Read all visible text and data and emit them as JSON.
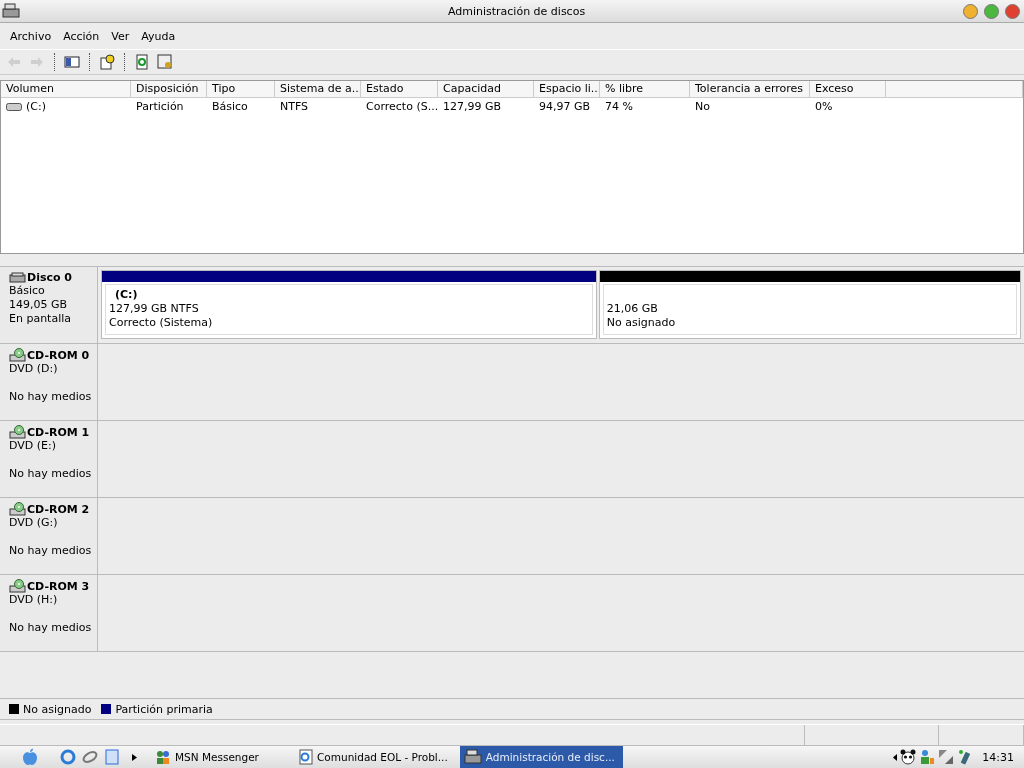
{
  "window": {
    "title": "Administración de discos"
  },
  "menu": [
    "Archivo",
    "Acción",
    "Ver",
    "Ayuda"
  ],
  "toolbar": [
    {
      "kind": "back",
      "disabled": true
    },
    {
      "kind": "forward",
      "disabled": true
    },
    {
      "kind": "panel",
      "disabled": false
    },
    {
      "kind": "help",
      "disabled": false
    },
    {
      "kind": "refresh",
      "disabled": false
    },
    {
      "kind": "properties",
      "disabled": false
    }
  ],
  "table": {
    "columns": [
      "Volumen",
      "Disposición",
      "Tipo",
      "Sistema de a...",
      "Estado",
      "Capacidad",
      "Espacio li...",
      "% libre",
      "Tolerancia a errores",
      "Exceso"
    ],
    "rows": [
      {
        "cells": [
          "(C:)",
          "Partición",
          "Básico",
          "NTFS",
          "Correcto (S...",
          "127,99 GB",
          "94,97 GB",
          "74 %",
          "No",
          "0%"
        ]
      }
    ]
  },
  "disks": [
    {
      "kind": "disk",
      "name": "Disco 0",
      "type": "Básico",
      "size": "149,05 GB",
      "status": "En pantalla",
      "partitions": [
        {
          "label": "(C:)",
          "detail": "127,99 GB NTFS",
          "status": "Correcto (Sistema)",
          "color": "#000080"
        },
        {
          "detail": "21,06 GB",
          "status": "No asignado",
          "color": "#000000"
        }
      ]
    },
    {
      "kind": "cdrom",
      "name": "CD-ROM 0",
      "type": "DVD (D:)",
      "status": "No hay medios"
    },
    {
      "kind": "cdrom",
      "name": "CD-ROM 1",
      "type": "DVD (E:)",
      "status": "No hay medios"
    },
    {
      "kind": "cdrom",
      "name": "CD-ROM 2",
      "type": "DVD (G:)",
      "status": "No hay medios"
    },
    {
      "kind": "cdrom",
      "name": "CD-ROM 3",
      "type": "DVD (H:)",
      "status": "No hay medios"
    }
  ],
  "legend": [
    {
      "label": "No asignado",
      "color": "#000000"
    },
    {
      "label": "Partición primaria",
      "color": "#000080"
    }
  ],
  "taskbar": {
    "tasks": [
      {
        "kind": "messenger",
        "label": "MSN Messenger",
        "selected": false
      },
      {
        "kind": "browser",
        "label": "Comunidad EOL - Probl...",
        "selected": false
      },
      {
        "kind": "disk",
        "label": "Administración de disc...",
        "selected": true
      }
    ],
    "clock": "14:31"
  }
}
